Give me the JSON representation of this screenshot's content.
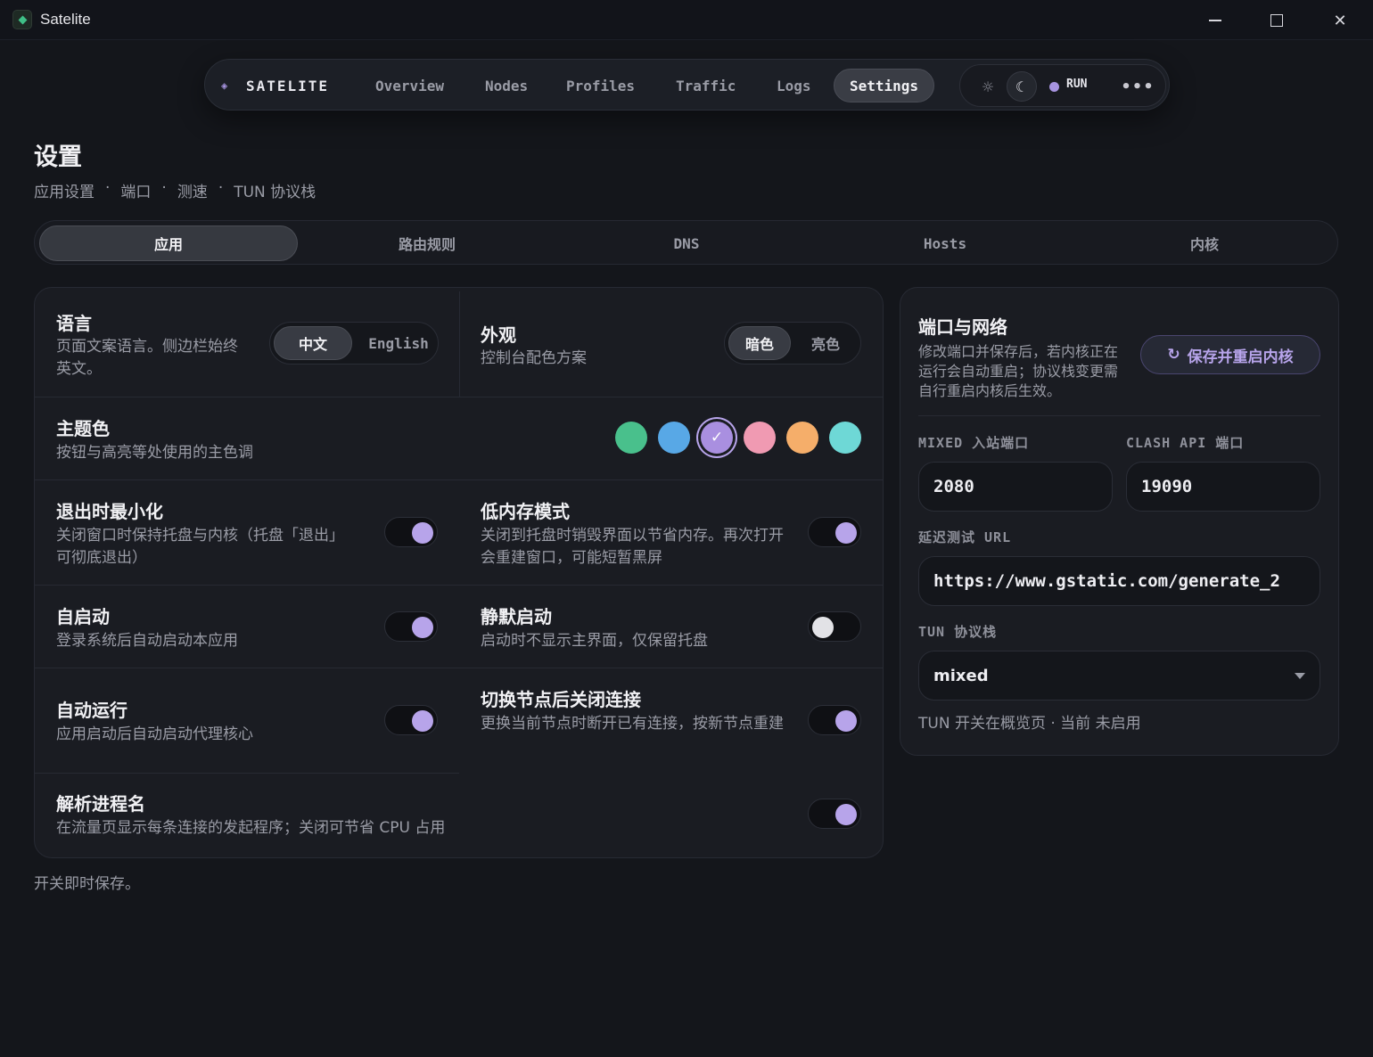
{
  "window": {
    "title": "Satelite",
    "controls": [
      "minimize",
      "maximize",
      "close"
    ]
  },
  "nav": {
    "brand": "SATELITE",
    "tabs": [
      "Overview",
      "Nodes",
      "Profiles",
      "Traffic",
      "Logs",
      "Settings"
    ],
    "active_tab": "Settings",
    "run_label": "RUN",
    "more": "•••"
  },
  "page": {
    "title": "设置",
    "subtitle_parts": [
      "应用设置",
      "端口",
      "测速",
      "TUN 协议栈"
    ],
    "separator": "·"
  },
  "tabs": [
    "应用",
    "路由规则",
    "DNS",
    "Hosts",
    "内核"
  ],
  "active_tab": "应用",
  "settings": {
    "language": {
      "title": "语言",
      "desc": "页面文案语言。侧边栏始终英文。",
      "options": [
        "中文",
        "English"
      ],
      "selected": "中文"
    },
    "appearance": {
      "title": "外观",
      "desc": "控制台配色方案",
      "options": [
        "暗色",
        "亮色"
      ],
      "selected": "暗色"
    },
    "theme_color": {
      "title": "主题色",
      "desc": "按钮与高亮等处使用的主色调",
      "swatches": [
        "#49c08c",
        "#58a8e6",
        "#a98fe0",
        "#f09ab2",
        "#f5ae6a",
        "#6ed8d6"
      ],
      "selected_index": 2,
      "check": "✓"
    },
    "minimize_on_exit": {
      "title": "退出时最小化",
      "desc": "关闭窗口时保持托盘与内核（托盘「退出」可彻底退出）",
      "on": true
    },
    "low_memory": {
      "title": "低内存模式",
      "desc": "关闭到托盘时销毁界面以节省内存。再次打开会重建窗口，可能短暂黑屏",
      "on": true
    },
    "autostart": {
      "title": "自启动",
      "desc": "登录系统后自动启动本应用",
      "on": true
    },
    "silent_start": {
      "title": "静默启动",
      "desc": "启动时不显示主界面，仅保留托盘",
      "on": false
    },
    "auto_run": {
      "title": "自动运行",
      "desc": "应用启动后自动启动代理核心",
      "on": true
    },
    "close_conn_on_switch": {
      "title": "切换节点后关闭连接",
      "desc": "更换当前节点时断开已有连接，按新节点重建",
      "on": true
    },
    "resolve_process": {
      "title": "解析进程名",
      "desc": "在流量页显示每条连接的发起程序；关闭可节省 CPU 占用",
      "on": true
    }
  },
  "network": {
    "title": "端口与网络",
    "desc": "修改端口并保存后，若内核正在运行会自动重启；协议栈变更需自行重启内核后生效。",
    "save_button": "保存并重启内核",
    "save_icon": "↻",
    "mixed_port_label": "MIXED 入站端口",
    "mixed_port": "2080",
    "clash_api_label": "CLASH API 端口",
    "clash_api_port": "19090",
    "latency_url_label": "延迟测试 URL",
    "latency_url": "https://www.gstatic.com/generate_2",
    "tun_stack_label": "TUN 协议栈",
    "tun_stack": "mixed",
    "tun_note": "TUN 开关在概览页 · 当前 未启用"
  },
  "footer_note": "开关即时保存。",
  "colors": {
    "accent": "#b7a4ea",
    "background": "#14161b",
    "card": "#1a1c22"
  }
}
